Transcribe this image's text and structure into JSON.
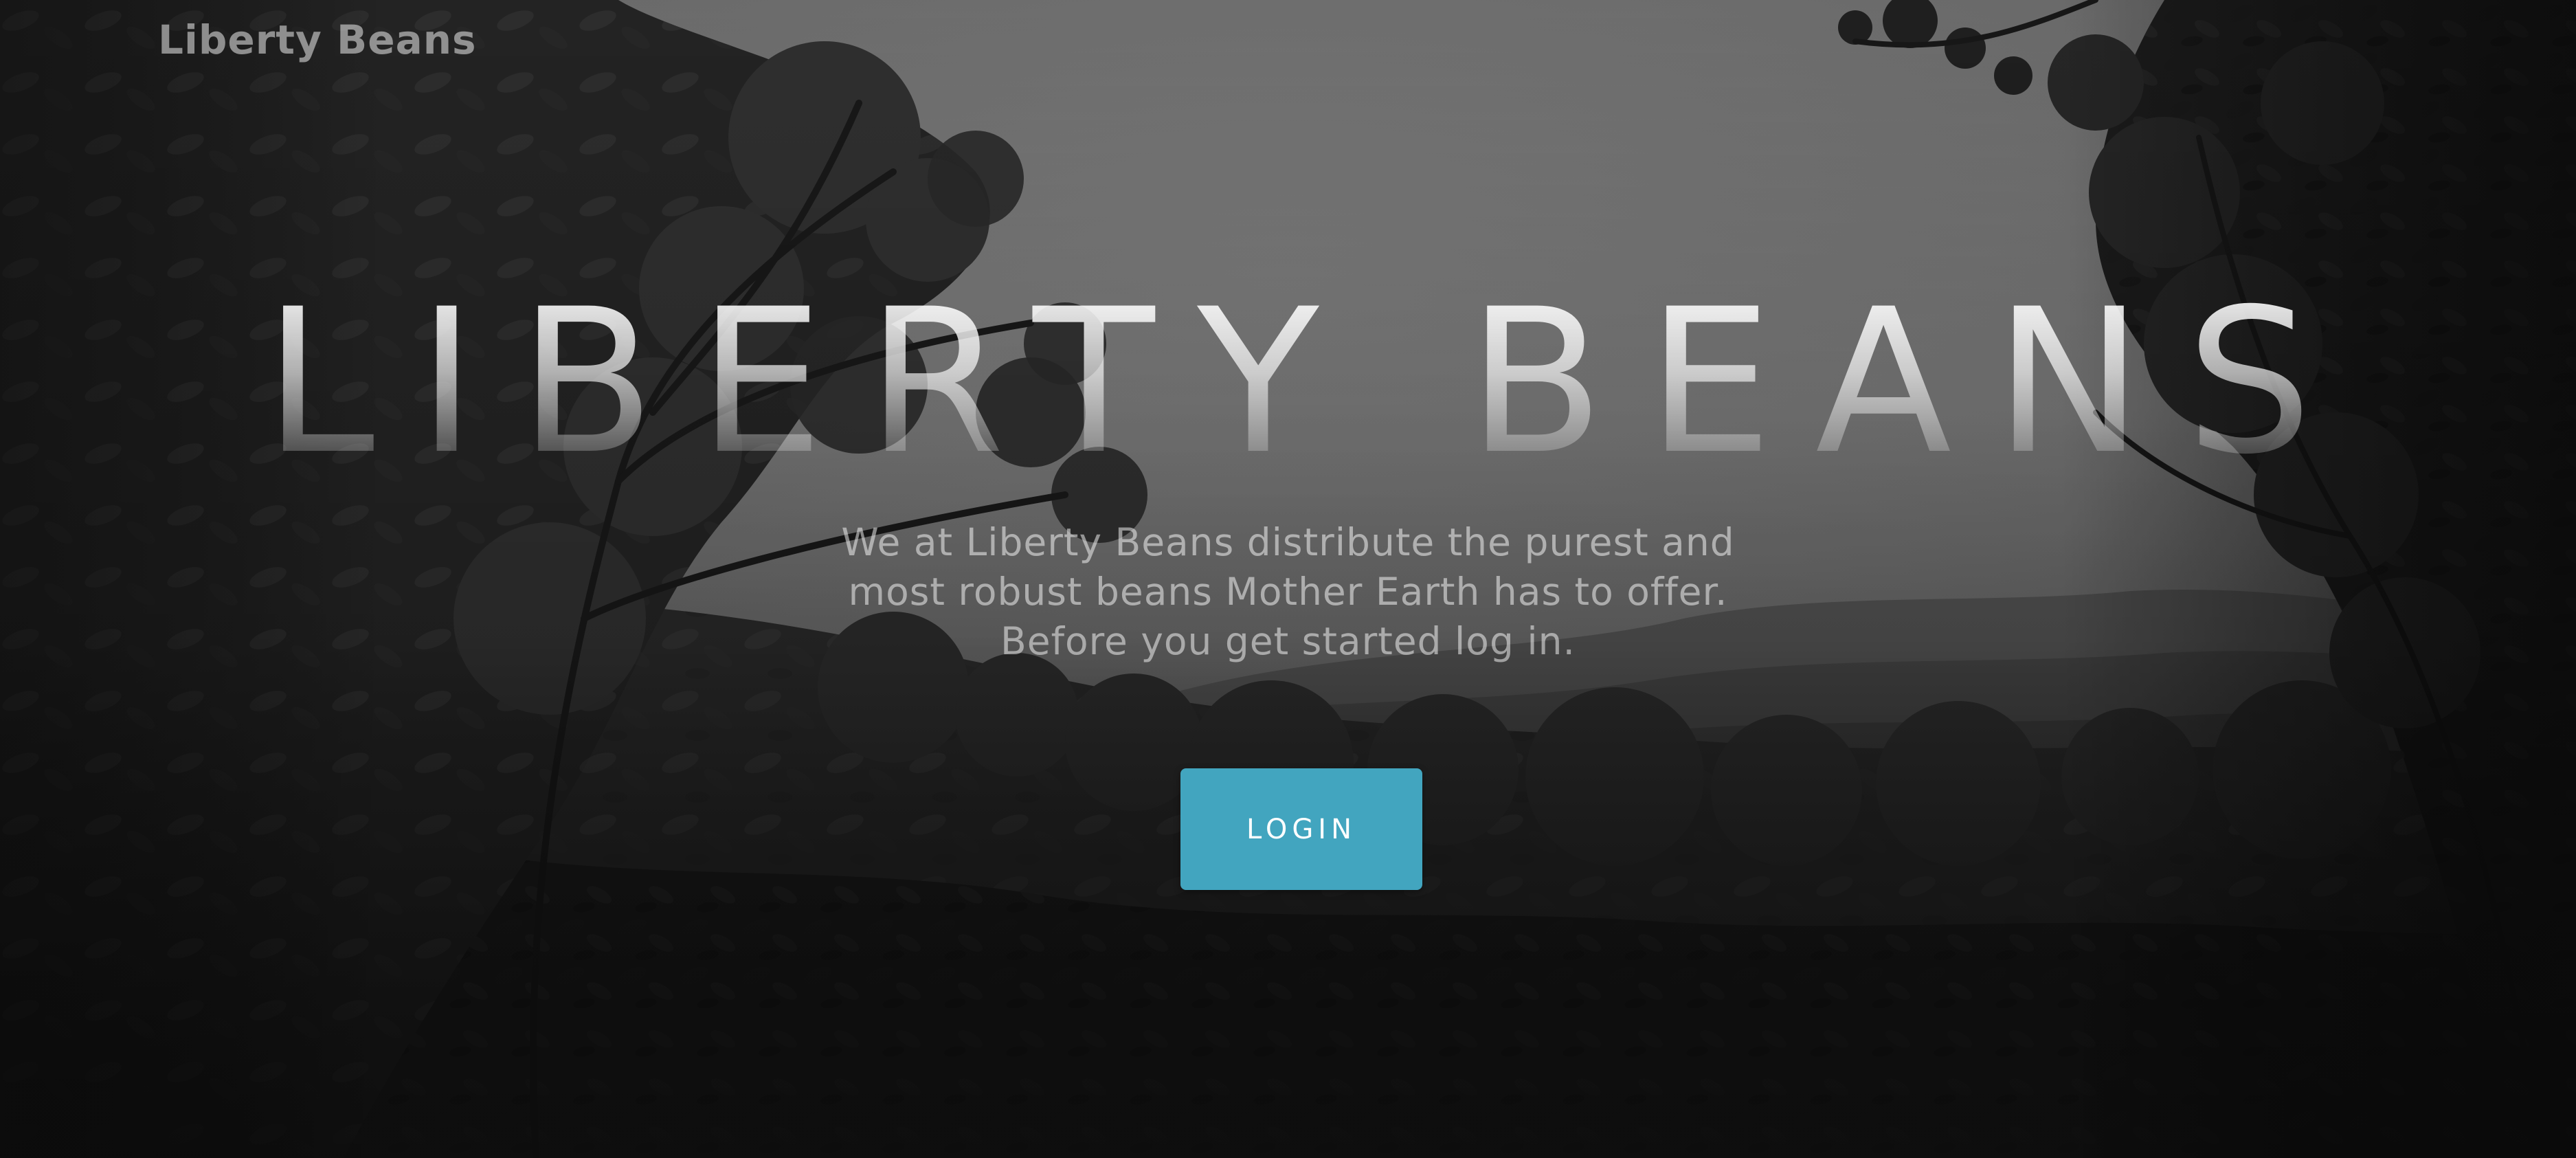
{
  "navbar": {
    "brand": "Liberty Beans"
  },
  "masthead": {
    "title": "LIBERTY BEANS",
    "description_lines": [
      "We at Liberty Beans distribute the purest and",
      "most robust beans Mother Earth has to offer.",
      "Before you get started log in."
    ],
    "login_label": "LOGIN"
  },
  "colors": {
    "button": "#42a5bf",
    "overlay": "#141414"
  }
}
